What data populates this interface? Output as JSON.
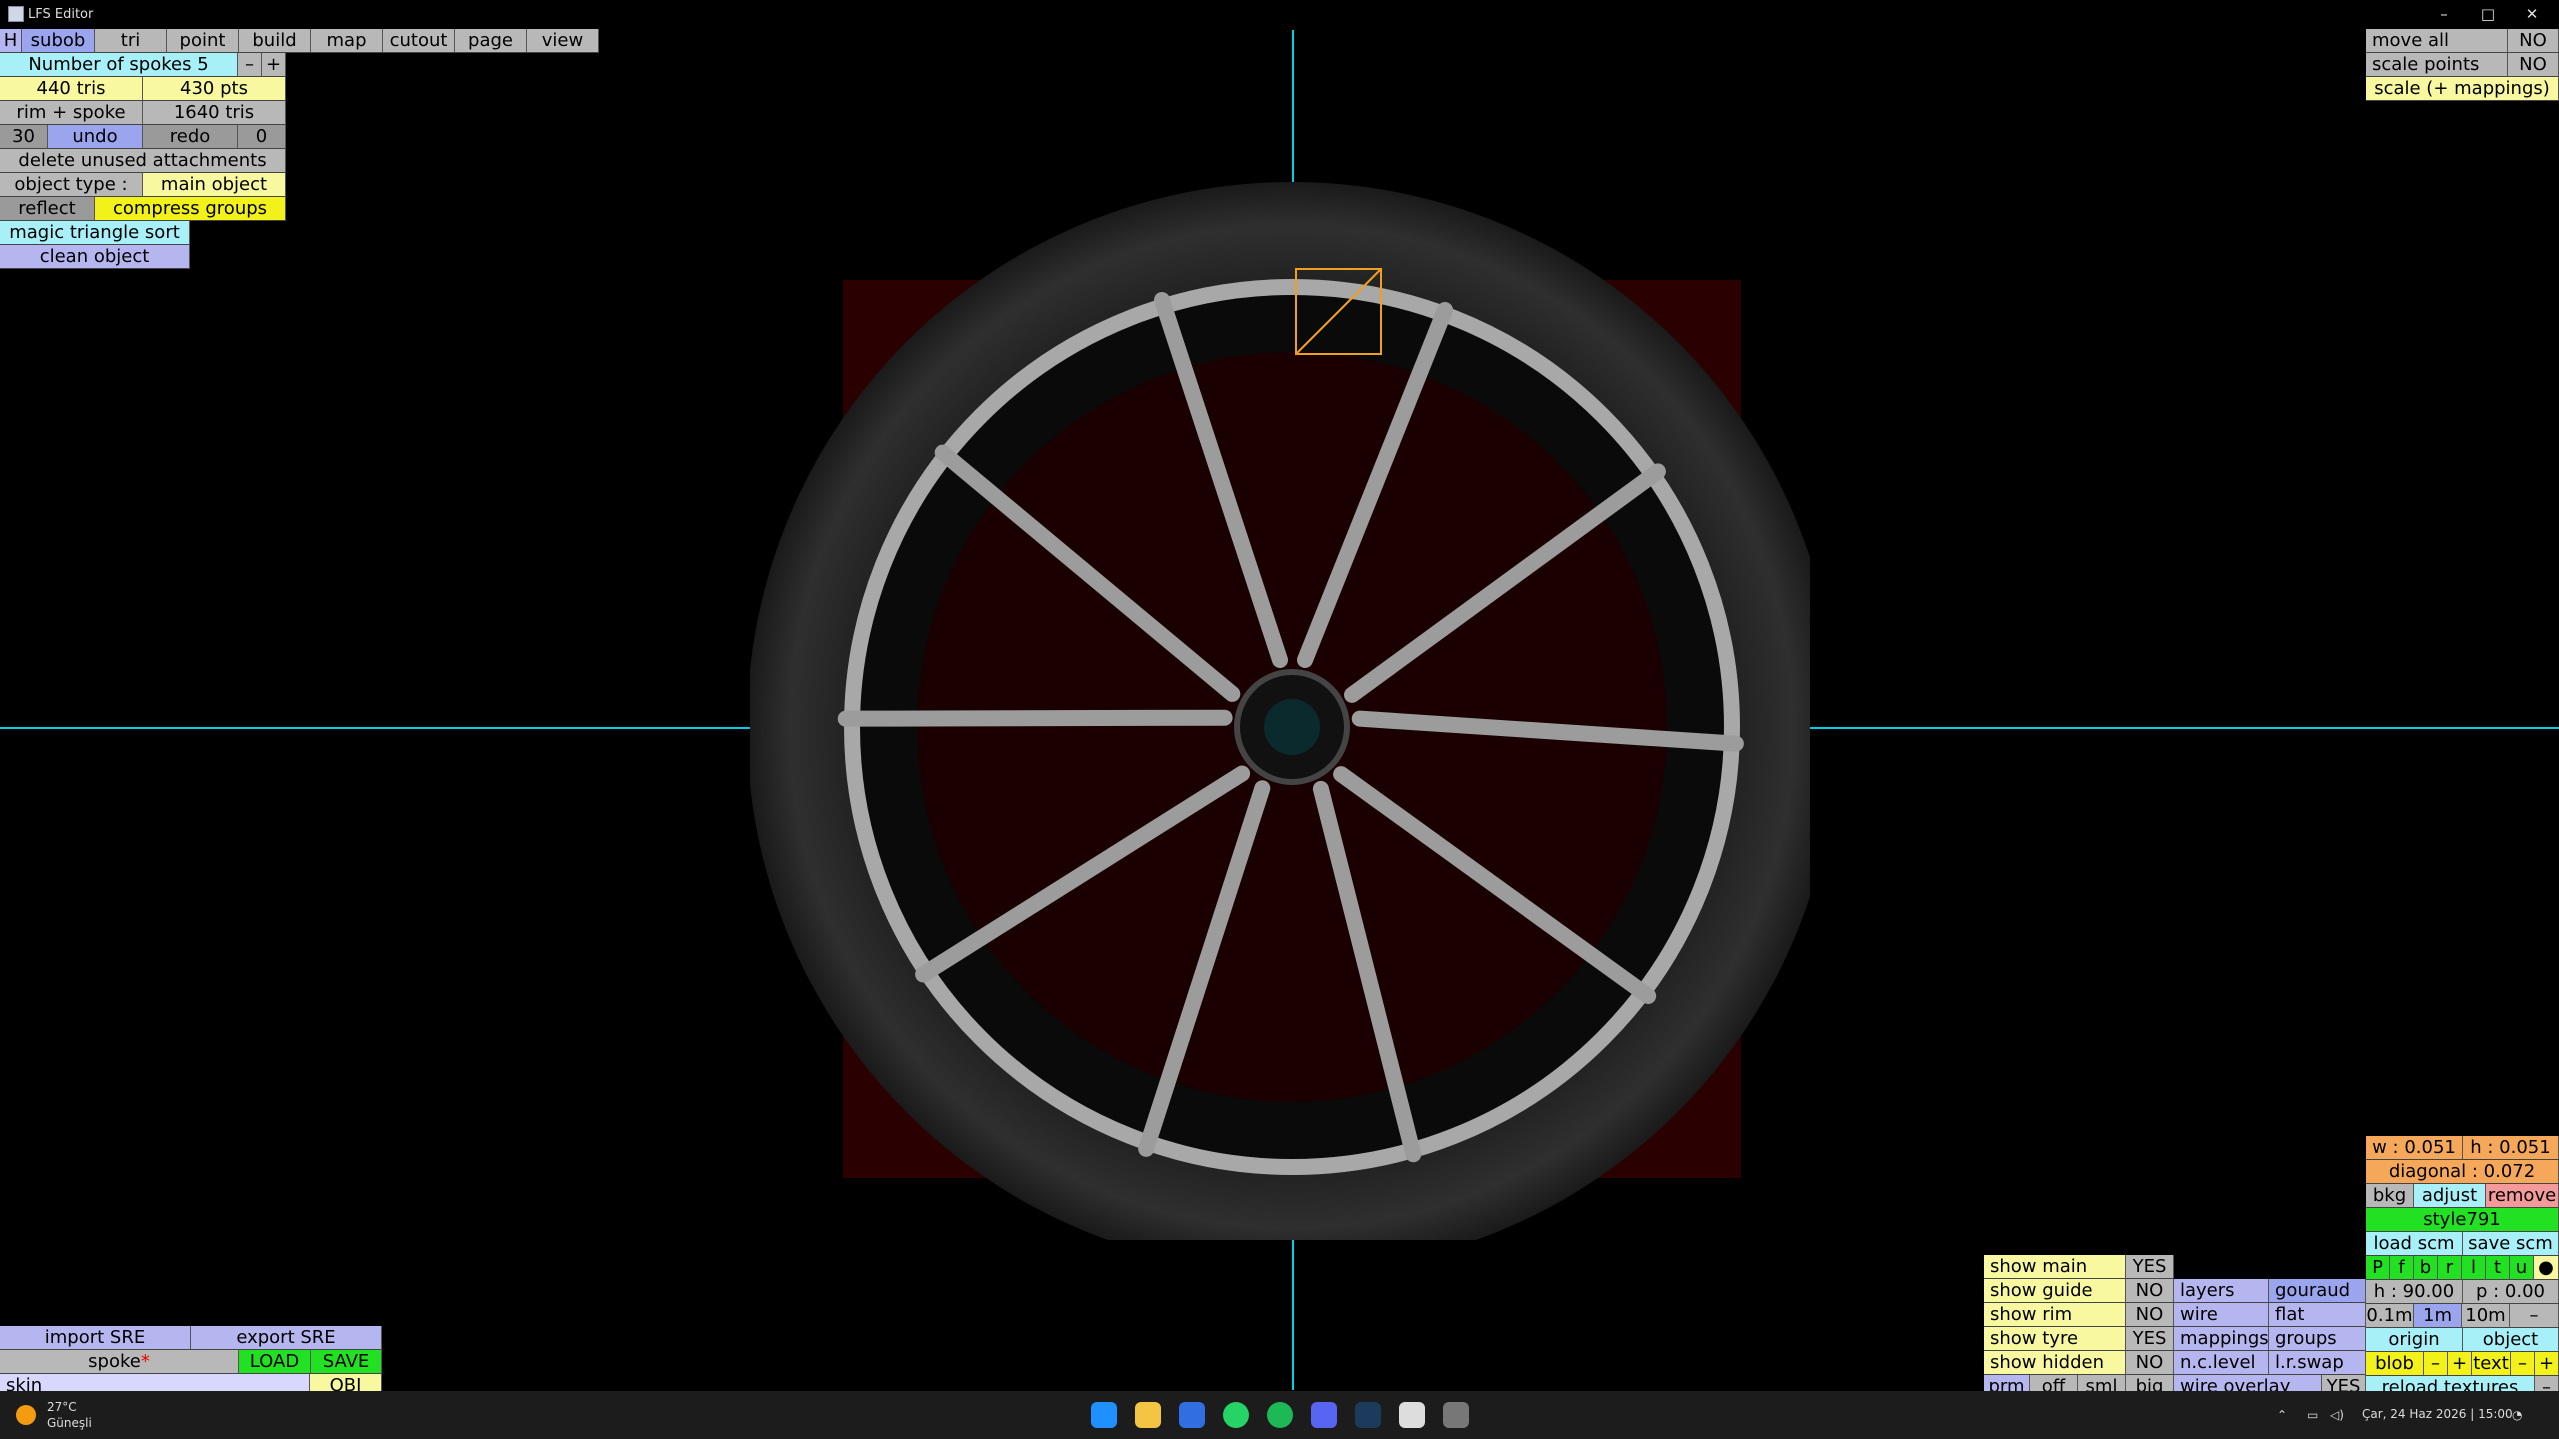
{
  "window": {
    "title": "LFS Editor",
    "min": "–",
    "max": "□",
    "close": "✕"
  },
  "menu": {
    "h": "H",
    "items": [
      "subob",
      "tri",
      "point",
      "build",
      "map",
      "cutout",
      "page",
      "view"
    ]
  },
  "left": {
    "spokes": "Number of spokes 5",
    "minus": "–",
    "plus": "+",
    "tris": "440 tris",
    "pts": "430 pts",
    "rimspoke": "rim + spoke",
    "rimtris": "1640 tris",
    "undo_n": "30",
    "undo": "undo",
    "redo": "redo",
    "redo_n": "0",
    "delete": "delete unused attachments",
    "objtype_label": "object type :",
    "objtype_val": "main object",
    "reflect": "reflect",
    "compress": "compress groups",
    "magic": "magic triangle sort",
    "clean": "clean object"
  },
  "topright": {
    "moveall": "move all",
    "moveall_v": "NO",
    "scalepoints": "scale points",
    "scalepoints_v": "NO",
    "scale_map": "scale (+ mappings)"
  },
  "bottomleft": {
    "import": "import SRE",
    "export": "export SRE",
    "spoke": "spoke",
    "star": "*",
    "load": "LOAD",
    "save": "SAVE",
    "skin": "skin",
    "obj": "OBJ"
  },
  "bottomright": {
    "w": "w : 0.051",
    "h": "h : 0.051",
    "diagonal": "diagonal : 0.072",
    "bkg": "bkg",
    "adjust": "adjust",
    "remove": "remove",
    "style": "style791",
    "loadscm": "load scm",
    "savescm": "save scm",
    "pletters": [
      "P",
      "f",
      "b",
      "r",
      "l",
      "t",
      "u",
      "●"
    ],
    "hval": "h : 90.00",
    "pval": "p : 0.00",
    "dist": [
      "0.1m",
      "1m",
      "10m",
      "–"
    ],
    "origin": "origin",
    "object": "object",
    "blob": "blob",
    "bminus": "–",
    "bplus": "+",
    "text": "text",
    "tminus": "–",
    "tplus": "+",
    "reload": "reload textures",
    "rminus": "–",
    "show": [
      {
        "l": "show main",
        "v": "YES"
      },
      {
        "l": "show guide",
        "v": "NO"
      },
      {
        "l": "show rim",
        "v": "NO"
      },
      {
        "l": "show tyre",
        "v": "YES"
      },
      {
        "l": "show hidden",
        "v": "NO"
      }
    ],
    "layers": "layers",
    "gouraud": "gouraud",
    "wire": "wire",
    "flat": "flat",
    "mappings": "mappings",
    "groups": "groups",
    "nclevel": "n.c.level",
    "lrswap": "l.r.swap",
    "prm": "prm",
    "off": "off",
    "sml": "sml",
    "big": "big",
    "wireoverlay": "wire overlay",
    "wo_v": "YES"
  },
  "taskbar": {
    "temp": "27°C",
    "weather": "Güneşli",
    "datetime": "Çar, 24 Haz 2026 | 15:00"
  },
  "colors": {
    "cyan_axis": "#00cfe6",
    "sel_orange": "#f0a020"
  }
}
